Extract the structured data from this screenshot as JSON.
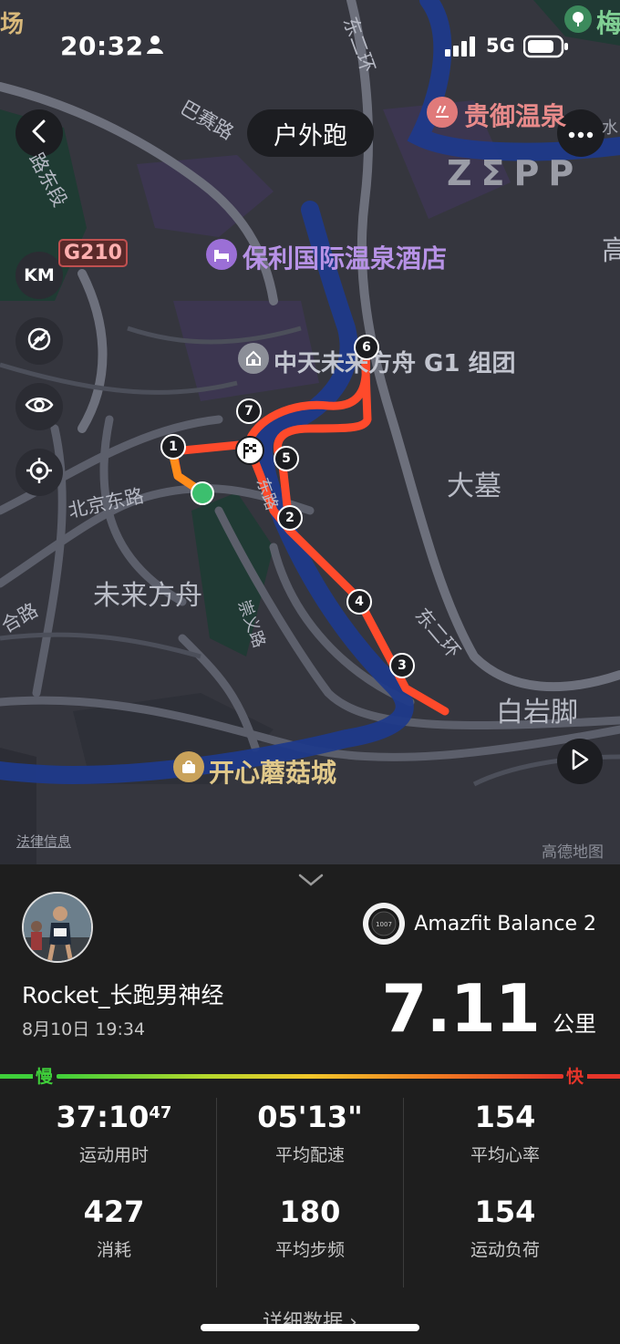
{
  "status_bar": {
    "time": "20:32",
    "network": "5G"
  },
  "header": {
    "title": "户外跑"
  },
  "map": {
    "side_buttons": [
      {
        "name": "unit-toggle",
        "label": "KM"
      }
    ],
    "labels": {
      "chang": "场",
      "mei": "梅",
      "guiyu_hot_spring": "贵御温泉",
      "zepp": "ZΣPP",
      "shui": "水",
      "poly_hotel": "保利国际温泉酒店",
      "g210": "G210",
      "zhongtian": "中天未来方舟 G1 组团",
      "da_mu": "大墓",
      "gao": "高",
      "beijing_dong_lu": "北京东路",
      "weilai_fangzhou": "未来方舟",
      "baiyanjiao": "白岩脚",
      "kaixin_mogucheng": "开心蘑菇城",
      "dong_er_huan_1": "东二环",
      "dong_er_huan_2": "东二环",
      "ba_sai_lu": "巴赛路",
      "lu_dong_duan": "路东段",
      "chongyi_lu": "崇义路",
      "he_lu": "合路",
      "dong_lu_mark": "东路",
      "legal_info": "法律信息",
      "gaode": "高德地图"
    },
    "km_markers": [
      "1",
      "2",
      "3",
      "4",
      "5",
      "6",
      "7"
    ]
  },
  "panel": {
    "device_name": "Amazfit Balance 2",
    "watch_face_text": "1007",
    "username": "Rocket_长跑男神经",
    "datetime": "8月10日 19:34",
    "distance_value": "7.11",
    "distance_unit": "公里",
    "pace_slow_label": "慢",
    "pace_fast_label": "快",
    "stats": [
      {
        "value": "37:10",
        "value_sup": "47",
        "label": "运动用时"
      },
      {
        "value": "05'13\"",
        "label": "平均配速"
      },
      {
        "value": "154",
        "label": "平均心率"
      },
      {
        "value": "427",
        "label": "消耗"
      },
      {
        "value": "180",
        "label": "平均步频"
      },
      {
        "value": "154",
        "label": "运动负荷"
      }
    ],
    "detail_link": "详细数据 ›"
  },
  "colors": {
    "route": "#ff4a2b",
    "route_start": "#ff8c1a",
    "river": "#1f3a8a",
    "start_dot": "#3cbf6e",
    "poi_purple": "#b792e6"
  }
}
